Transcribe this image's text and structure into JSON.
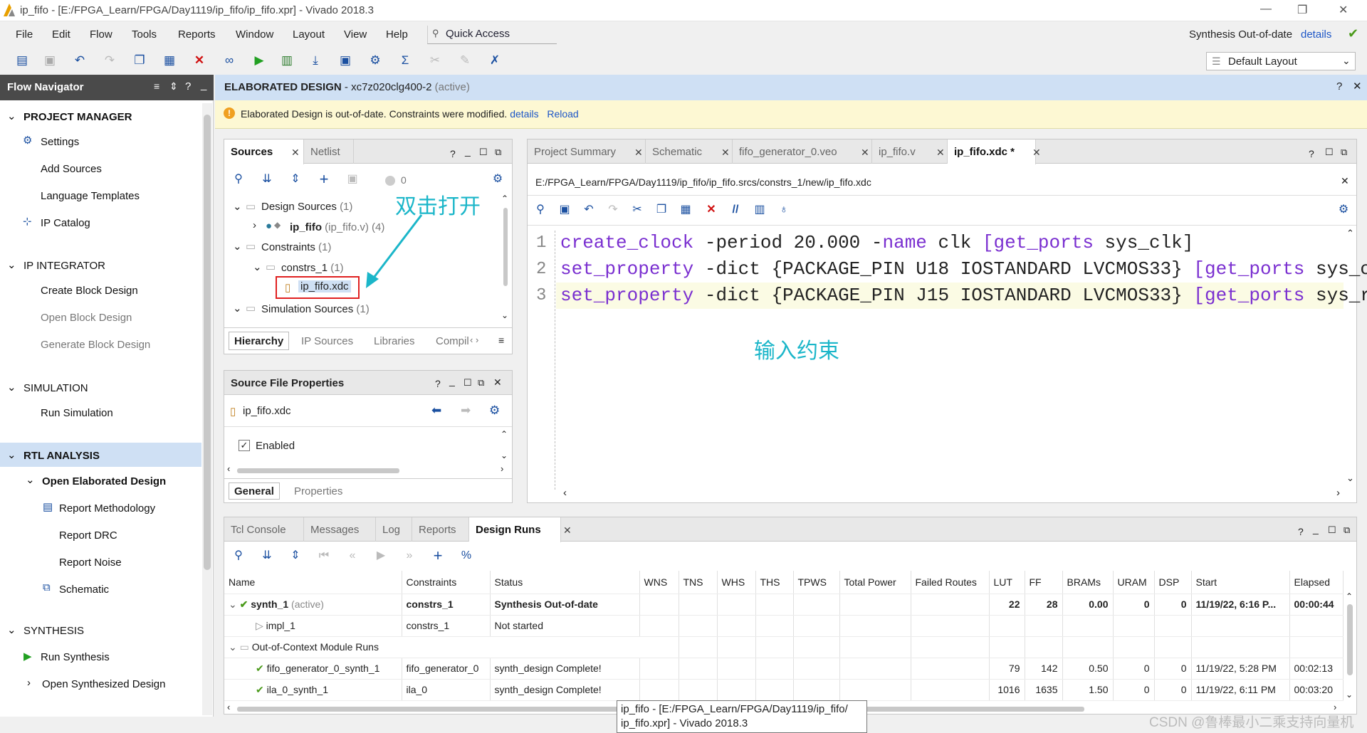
{
  "window": {
    "title": "ip_fifo - [E:/FPGA_Learn/FPGA/Day1119/ip_fifo/ip_fifo.xpr] - Vivado 2018.3"
  },
  "menu": [
    "File",
    "Edit",
    "Flow",
    "Tools",
    "Reports",
    "Window",
    "Layout",
    "View",
    "Help"
  ],
  "quick_access": "Quick Access",
  "synth_status": {
    "text": "Synthesis Out-of-date",
    "link": "details"
  },
  "layout_select": "Default Layout",
  "flow_nav": {
    "title": "Flow Navigator",
    "sections": [
      {
        "label": "PROJECT MANAGER",
        "items": [
          "Settings",
          "Add Sources",
          "Language Templates",
          "IP Catalog"
        ]
      },
      {
        "label": "IP INTEGRATOR",
        "items": [
          "Create Block Design",
          "Open Block Design",
          "Generate Block Design"
        ]
      },
      {
        "label": "SIMULATION",
        "items": [
          "Run Simulation"
        ]
      },
      {
        "label": "RTL ANALYSIS",
        "items": [
          "Open Elaborated Design",
          "Report Methodology",
          "Report DRC",
          "Report Noise",
          "Schematic"
        ]
      },
      {
        "label": "SYNTHESIS",
        "items": [
          "Run Synthesis",
          "Open Synthesized Design"
        ]
      }
    ]
  },
  "design_header": {
    "title": "ELABORATED DESIGN",
    "part": " - xc7z020clg400-2",
    "state": " (active)"
  },
  "warning": {
    "text": "Elaborated Design is out-of-date. Constraints were modified.",
    "details": "details",
    "reload": "Reload"
  },
  "sources": {
    "tabs": [
      "Sources",
      "Netlist"
    ],
    "count": "0",
    "tree": {
      "design_sources": "Design Sources",
      "design_count": "(1)",
      "ip_fifo": "ip_fifo",
      "ip_fifo_file": "(ip_fifo.v) (4)",
      "constraints": "Constraints",
      "constraints_count": "(1)",
      "constrs": "constrs_1",
      "constrs_count": "(1)",
      "xdc": "ip_fifo.xdc",
      "sim_sources": "Simulation Sources",
      "sim_count": "(1)"
    },
    "bottom_tabs": [
      "Hierarchy",
      "IP Sources",
      "Libraries",
      "Compil"
    ]
  },
  "annotations": {
    "double_click": "双击打开",
    "input_constraints": "输入约束"
  },
  "sfp": {
    "title": "Source File Properties",
    "file": "ip_fifo.xdc",
    "enabled": "Enabled",
    "tabs": [
      "General",
      "Properties"
    ]
  },
  "editor": {
    "tabs": [
      "Project Summary",
      "Schematic",
      "fifo_generator_0.veo",
      "ip_fifo.v",
      "ip_fifo.xdc *"
    ],
    "path": "E:/FPGA_Learn/FPGA/Day1119/ip_fifo/ip_fifo.srcs/constrs_1/new/ip_fifo.xdc",
    "lines": [
      {
        "n": "1",
        "a": "create_clock",
        "b": " -period 20.000 -",
        "c": "name",
        "d": " clk ",
        "e": "[get_ports",
        "f": " sys_clk]"
      },
      {
        "n": "2",
        "a": "set_property",
        "b": " -dict {PACKAGE_PIN U18 IOSTANDARD LVCMOS33} ",
        "e": "[get_ports",
        "f": " sys_clk]"
      },
      {
        "n": "3",
        "a": "set_property",
        "b": " -dict {PACKAGE_PIN J15 IOSTANDARD LVCMOS33} ",
        "e": "[get_ports",
        "f": " sys_rst_n]"
      }
    ]
  },
  "runs": {
    "tabs": [
      "Tcl Console",
      "Messages",
      "Log",
      "Reports",
      "Design Runs"
    ],
    "columns": [
      "Name",
      "Constraints",
      "Status",
      "WNS",
      "TNS",
      "WHS",
      "THS",
      "TPWS",
      "Total Power",
      "Failed Routes",
      "LUT",
      "FF",
      "BRAMs",
      "URAM",
      "DSP",
      "Start",
      "Elapsed"
    ],
    "rows": [
      {
        "name": "synth_1",
        "active": " (active)",
        "constraints": "constrs_1",
        "status": "Synthesis Out-of-date",
        "lut": "22",
        "ff": "28",
        "brams": "0.00",
        "uram": "0",
        "dsp": "0",
        "start": "11/19/22, 6:16 P...",
        "elapsed": "00:00:44"
      },
      {
        "name": "impl_1",
        "constraints": "constrs_1",
        "status": "Not started"
      },
      {
        "name": "Out-of-Context Module Runs"
      },
      {
        "name": "fifo_generator_0_synth_1",
        "constraints": "fifo_generator_0",
        "status": "synth_design Complete!",
        "lut": "79",
        "ff": "142",
        "brams": "0.50",
        "uram": "0",
        "dsp": "0",
        "start": "11/19/22, 5:28 PM",
        "elapsed": "00:02:13"
      },
      {
        "name": "ila_0_synth_1",
        "constraints": "ila_0",
        "status": "synth_design Complete!",
        "lut": "1016",
        "ff": "1635",
        "brams": "1.50",
        "uram": "0",
        "dsp": "0",
        "start": "11/19/22, 6:11 PM",
        "elapsed": "00:03:20"
      }
    ]
  },
  "tooltip": {
    "l1": "ip_fifo - [E:/FPGA_Learn/FPGA/Day1119/ip_fifo/",
    "l2": "ip_fifo.xpr] - Vivado 2018.3"
  },
  "watermark": "CSDN @鲁棒最小二乘支持向量机"
}
